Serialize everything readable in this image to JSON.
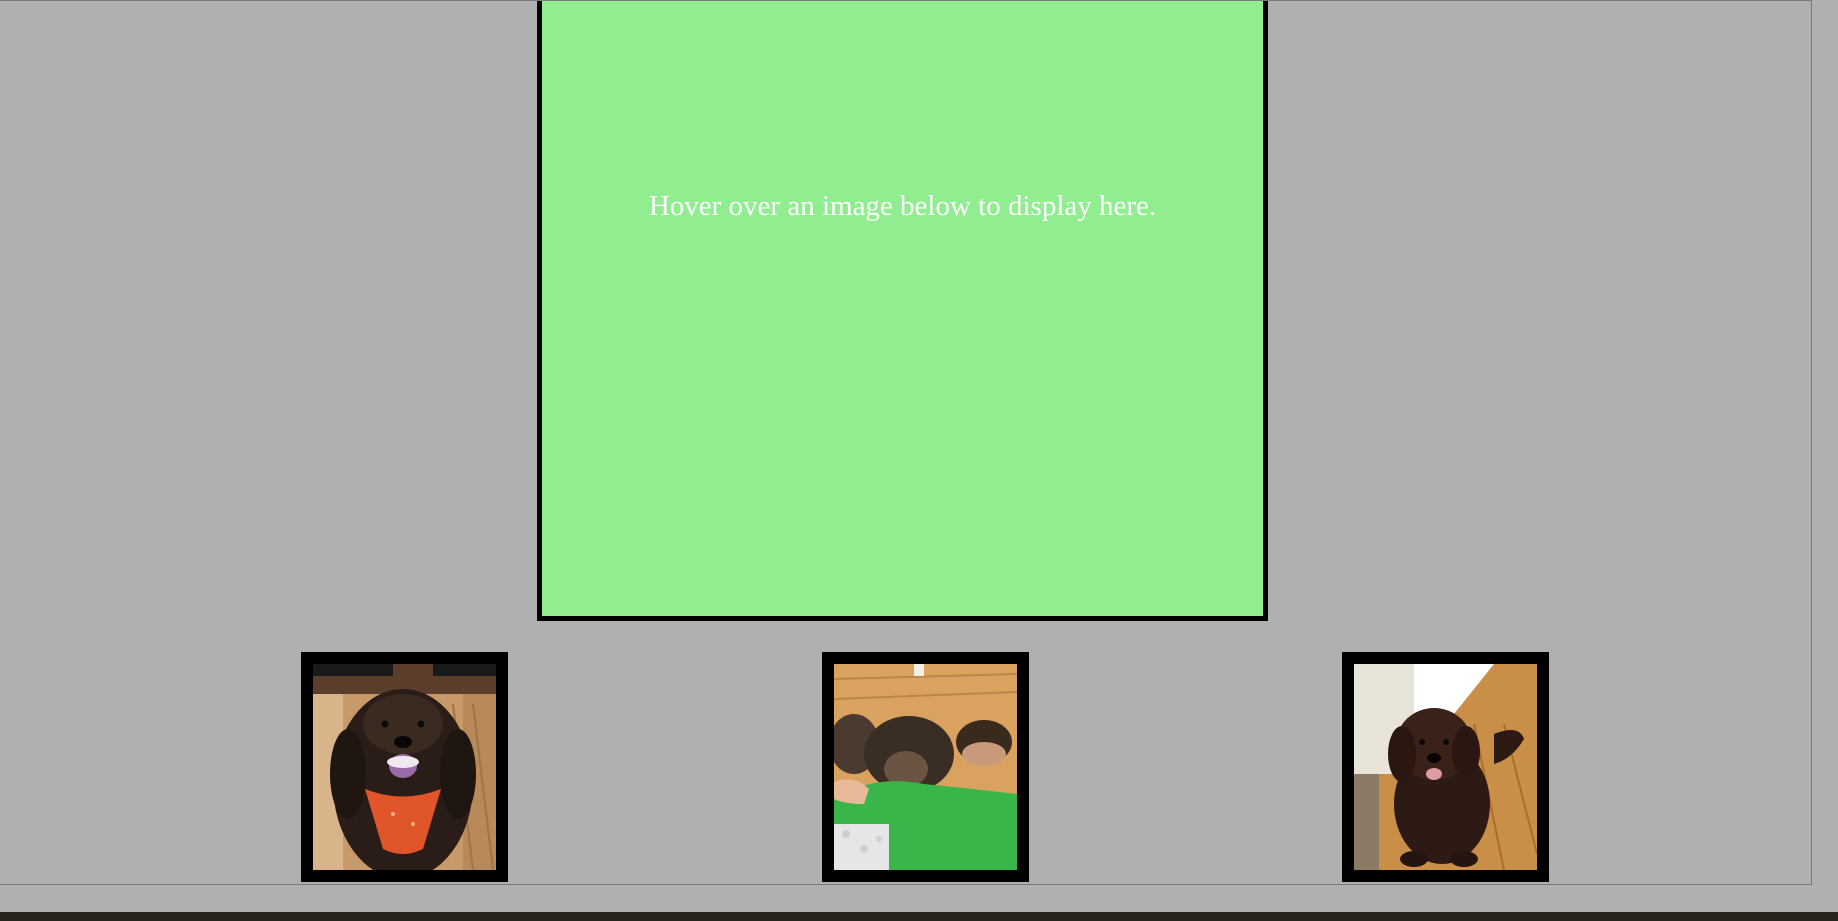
{
  "display": {
    "message": "Hover over an image below to display here.",
    "background_color": "#90ee90",
    "border_color": "#000000"
  },
  "gallery": {
    "images": [
      {
        "alt": "Dark brown doodle dog wearing an orange bandana"
      },
      {
        "alt": "Boy in green shirt hugging a brown dog on the floor"
      },
      {
        "alt": "Dark brown doodle dog sitting on wooden floor"
      }
    ]
  },
  "colors": {
    "page_background": "#b0b0b0",
    "thumbnail_frame": "#000000"
  }
}
